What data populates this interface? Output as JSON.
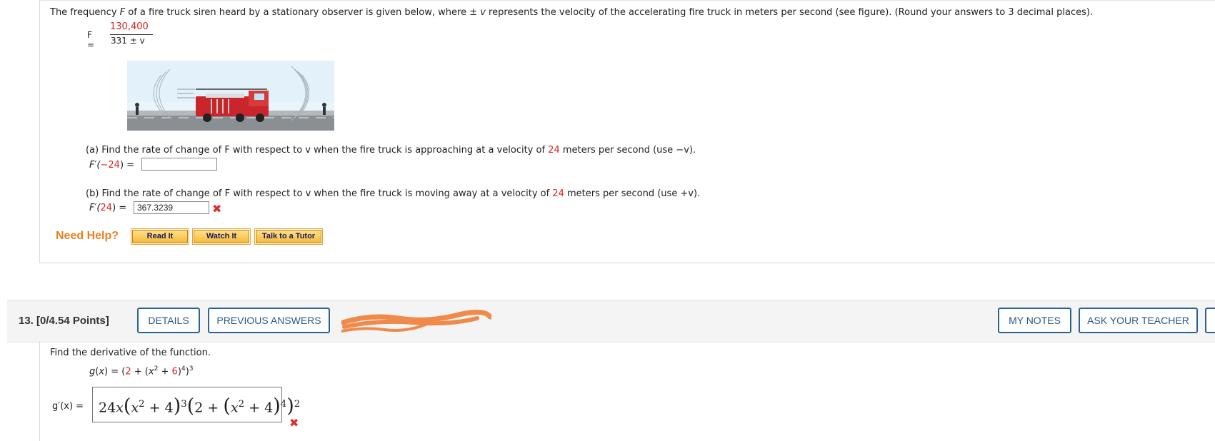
{
  "problem12": {
    "intro_a": "The frequency ",
    "intro_F": "F",
    "intro_b": " of a fire truck siren heard by a stationary observer is given below, where ± ",
    "intro_v": "v",
    "intro_c": " represents the velocity of the accelerating fire truck in meters per second (see figure). (Round your answers to 3 decimal places).",
    "formula_lhs": "F =",
    "formula_numerator": "130,400",
    "formula_denominator": "331 ± v",
    "part_a": {
      "prefix": "(a) Find the rate of change of F with respect to v when the fire truck is approaching at a velocity of ",
      "velocity": "24",
      "suffix": " meters per second (use −v).",
      "answer_label_pre": "F′(",
      "answer_label_arg": "−24",
      "answer_label_post": ") =",
      "answer_value": ""
    },
    "part_b": {
      "prefix": "(b) Find the rate of change of F with respect to v when the fire truck is moving away at a velocity of ",
      "velocity": "24",
      "suffix": " meters per second (use +v).",
      "answer_label_pre": "F′(",
      "answer_label_arg": "24",
      "answer_label_post": ") =",
      "answer_value": "367.3239"
    },
    "need_help": "Need Help?",
    "help_buttons": [
      "Read It",
      "Watch It",
      "Talk to a Tutor"
    ]
  },
  "problem13": {
    "header": "13.  [0/4.54 Points]",
    "buttons": {
      "details": "DETAILS",
      "previous_answers": "PREVIOUS ANSWERS",
      "my_notes": "MY NOTES",
      "ask_teacher": "ASK YOUR TEACHER"
    },
    "prompt": "Find the derivative of the function.",
    "gprime_label": "g′(x) ="
  },
  "colors": {
    "red": "#dd2222",
    "help_orange": "#e8801d",
    "button_blue": "#2a6496",
    "scribble": "#f08a4b"
  },
  "icons": [
    "x-mark-icon",
    "fire-truck-figure",
    "scribble-redaction"
  ]
}
